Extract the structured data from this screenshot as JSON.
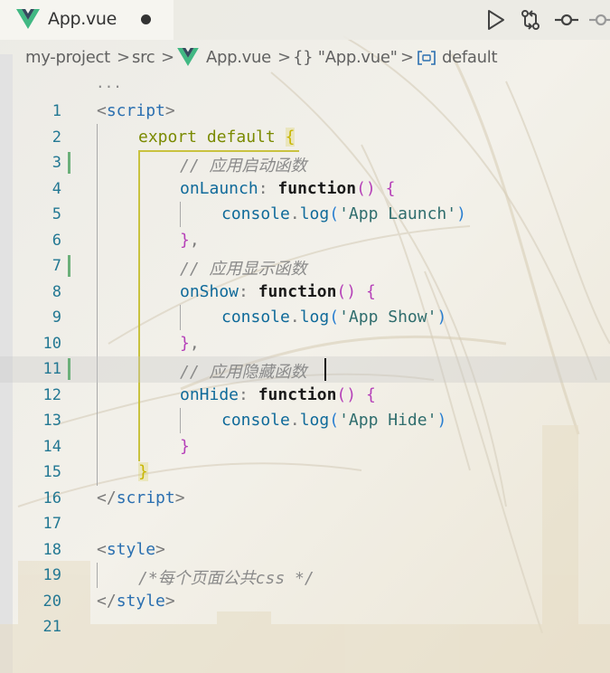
{
  "tab": {
    "title": "App.vue",
    "icon": "vue-logo-icon",
    "dirty": true
  },
  "toolbar": {
    "icons": [
      "run-icon",
      "compare-changes-icon",
      "git-commit-icon",
      "git-commit-icon"
    ]
  },
  "breadcrumb": {
    "project": "my-project",
    "folder": "src",
    "file": "App.vue",
    "object_label": "{} \"App.vue\"",
    "symbol": "default",
    "separator": ">",
    "overflow": "..."
  },
  "editor": {
    "current_line": 11,
    "lines": [
      {
        "n": "1"
      },
      {
        "n": "2"
      },
      {
        "n": "3"
      },
      {
        "n": "4"
      },
      {
        "n": "5"
      },
      {
        "n": "6"
      },
      {
        "n": "7"
      },
      {
        "n": "8"
      },
      {
        "n": "9"
      },
      {
        "n": "10"
      },
      {
        "n": "11"
      },
      {
        "n": "12"
      },
      {
        "n": "13"
      },
      {
        "n": "14"
      },
      {
        "n": "15"
      },
      {
        "n": "16"
      },
      {
        "n": "17"
      },
      {
        "n": "18"
      },
      {
        "n": "19"
      },
      {
        "n": "20"
      },
      {
        "n": "21"
      }
    ],
    "tokens": {
      "l1_open": "<",
      "l1_tag": "script",
      "l1_close": ">",
      "l2_kw": "export default",
      "l2_brace": "{",
      "l3_comment": "// 应用启动函数",
      "l4_prop": "onLaunch",
      "l4_colon": ": ",
      "l4_fn": "function",
      "l4_parens": "()",
      "l4_brace": "{",
      "l5_obj": "console",
      "l5_dot": ".",
      "l5_method": "log",
      "l5_paren_open": "(",
      "l5_str": "'App Launch'",
      "l5_paren_close": ")",
      "l6_brace": "}",
      "l6_comma": ",",
      "l7_comment": "// 应用显示函数",
      "l8_prop": "onShow",
      "l8_colon": ": ",
      "l8_fn": "function",
      "l8_parens": "()",
      "l8_brace": "{",
      "l9_obj": "console",
      "l9_dot": ".",
      "l9_method": "log",
      "l9_paren_open": "(",
      "l9_str": "'App Show'",
      "l9_paren_close": ")",
      "l10_brace": "}",
      "l10_comma": ",",
      "l11_comment": "// 应用隐藏函数",
      "l12_prop": "onHide",
      "l12_colon": ": ",
      "l12_fn": "function",
      "l12_parens": "()",
      "l12_brace": "{",
      "l13_obj": "console",
      "l13_dot": ".",
      "l13_method": "log",
      "l13_paren_open": "(",
      "l13_str": "'App Hide'",
      "l13_paren_close": ")",
      "l14_brace": "}",
      "l15_brace": "}",
      "l16_open": "</",
      "l16_tag": "script",
      "l16_close": ">",
      "l18_open": "<",
      "l18_tag": "style",
      "l18_close": ">",
      "l19_comment": "/*每个页面公共css */",
      "l20_open": "</",
      "l20_tag": "style",
      "l20_close": ">"
    }
  },
  "colors": {
    "line_number": "#237893",
    "tag": "#2a6fb0",
    "keyword": "#7a8a00",
    "comment": "#8a8a8a",
    "string": "#2f6d6d",
    "modified_gutter": "#6cb07a"
  }
}
